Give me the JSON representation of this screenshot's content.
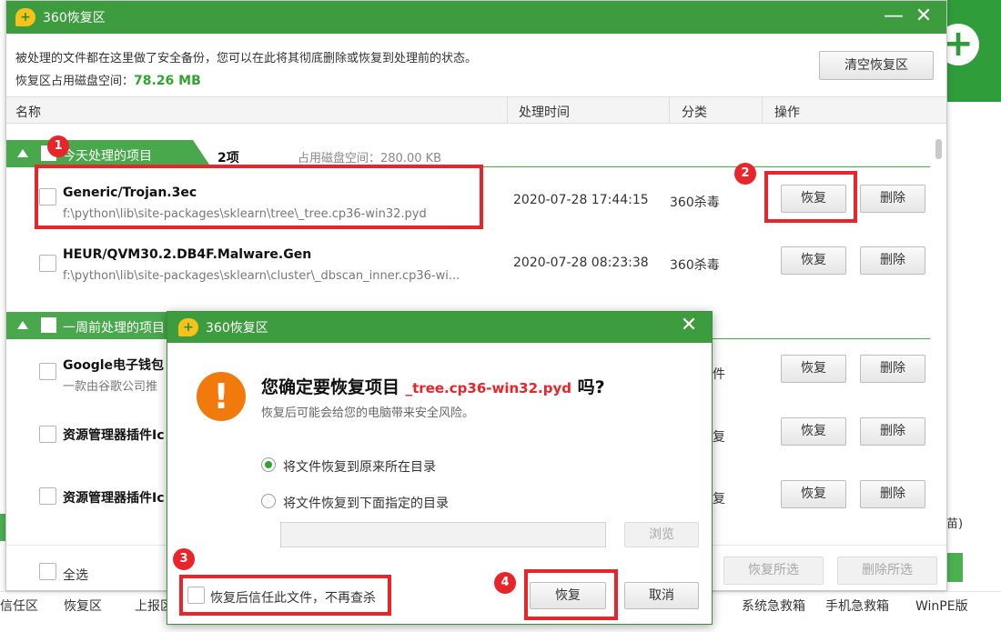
{
  "window": {
    "title": "360恢复区",
    "minimize": "—",
    "close": "✕"
  },
  "info": {
    "line1": "被处理的文件都在这里做了安全备份，您可以在此将其彻底删除或恢复到处理前的状态。",
    "disk_label": "恢复区占用磁盘空间：",
    "disk_value": "78.26 MB",
    "clear_button": "清空恢复区"
  },
  "table": {
    "headers": [
      "名称",
      "处理时间",
      "分类",
      "操作"
    ]
  },
  "groups": [
    {
      "label": "今天处理的项目",
      "count": "2项",
      "disk": "占用磁盘空间：280.00 KB",
      "items": [
        {
          "name": "Generic/Trojan.3ec",
          "path": "f:\\python\\lib\\site-packages\\sklearn\\tree\\_tree.cp36-win32.pyd",
          "time": "2020-07-28 17:44:15",
          "category": "360杀毒",
          "restore": "恢复",
          "delete": "删除"
        },
        {
          "name": "HEUR/QVM30.2.DB4F.Malware.Gen",
          "path": "f:\\python\\lib\\site-packages\\sklearn\\cluster\\_dbscan_inner.cp36-wi...",
          "time": "2020-07-28 08:23:38",
          "category": "360杀毒",
          "restore": "恢复",
          "delete": "删除"
        }
      ]
    },
    {
      "label": "一周前处理的项目",
      "items": [
        {
          "name": "Google电子钱包",
          "path": "一款由谷歌公司推",
          "category_tail": "件",
          "restore": "恢复",
          "delete": "删除"
        },
        {
          "name": "资源管理器插件Ic",
          "category_tail": "复",
          "restore": "恢复",
          "delete": "删除"
        },
        {
          "name": "资源管理器插件Ic",
          "category_tail": "复",
          "restore": "恢复",
          "delete": "删除"
        }
      ]
    }
  ],
  "footer": {
    "select_all": "全选",
    "restore_selected": "恢复所选",
    "delete_selected": "删除所选"
  },
  "background": {
    "tabs": [
      "信任区",
      "恢复区",
      "上报区",
      "系统急救箱",
      "手机急救箱",
      "WinPE版"
    ],
    "edge_text": "苗)",
    "plus": "+"
  },
  "dialog": {
    "title": "360恢复区",
    "close": "✕",
    "question_prefix": "您确定要恢复项目",
    "question_file": "_tree.cp36-win32.pyd",
    "question_suffix": "吗?",
    "subtitle": "恢复后可能会给您的电脑带来安全风险。",
    "option_original": "将文件恢复到原来所在目录",
    "option_custom": "将文件恢复到下面指定的目录",
    "browse": "浏览",
    "trust_checkbox": "恢复后信任此文件，不再查杀",
    "restore": "恢复",
    "cancel": "取消"
  },
  "annotations": {
    "badges": [
      "1",
      "2",
      "3",
      "4"
    ],
    "color": "#e8252b"
  },
  "colors": {
    "titlebar": "#3c9c3e",
    "accent_green": "#2fa52f",
    "warning": "#f07a0c"
  }
}
